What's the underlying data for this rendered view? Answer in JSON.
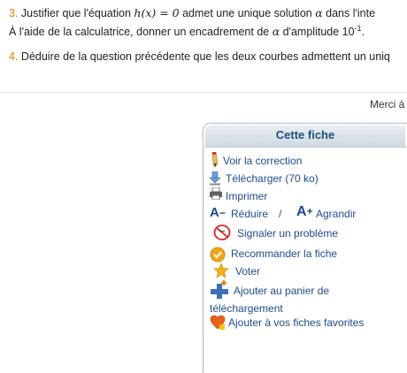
{
  "exercise": {
    "q3": {
      "number": "3.",
      "text_before": "Justifier que l'équation ",
      "equation": "h(x) = 0",
      "text_mid": " admet une unique solution ",
      "symbol": "α",
      "text_after": " dans l'inte",
      "line2_before": "À l'aide de la calculatrice, donner un encadrement de ",
      "line2_symbol": "α",
      "line2_after": " d'amplitude 10",
      "line2_exp": "-1",
      "line2_end": "."
    },
    "q4": {
      "number": "4.",
      "text": "Déduire de la question précédente que les deux courbes admettent un uniq"
    }
  },
  "merci": "Merci à",
  "panel": {
    "title": "Cette fiche",
    "items": {
      "correction": "Voir la correction",
      "telecharger": "Télécharger (70 ko)",
      "imprimer": "Imprimer",
      "reduire": "Réduire",
      "separator": "/",
      "agrandir": "Agrandir",
      "signaler": "Signaler un problème",
      "recommander": "Recommander la fiche",
      "voter": "Voter",
      "panier_line1": "Ajouter au panier de",
      "panier_line2": "téléchargement",
      "favorites": "Ajouter à vos fiches favorites"
    }
  },
  "colors": {
    "question_number": "#e67e00",
    "link": "#1f4a8a",
    "panel_title": "#1e4f7a"
  }
}
